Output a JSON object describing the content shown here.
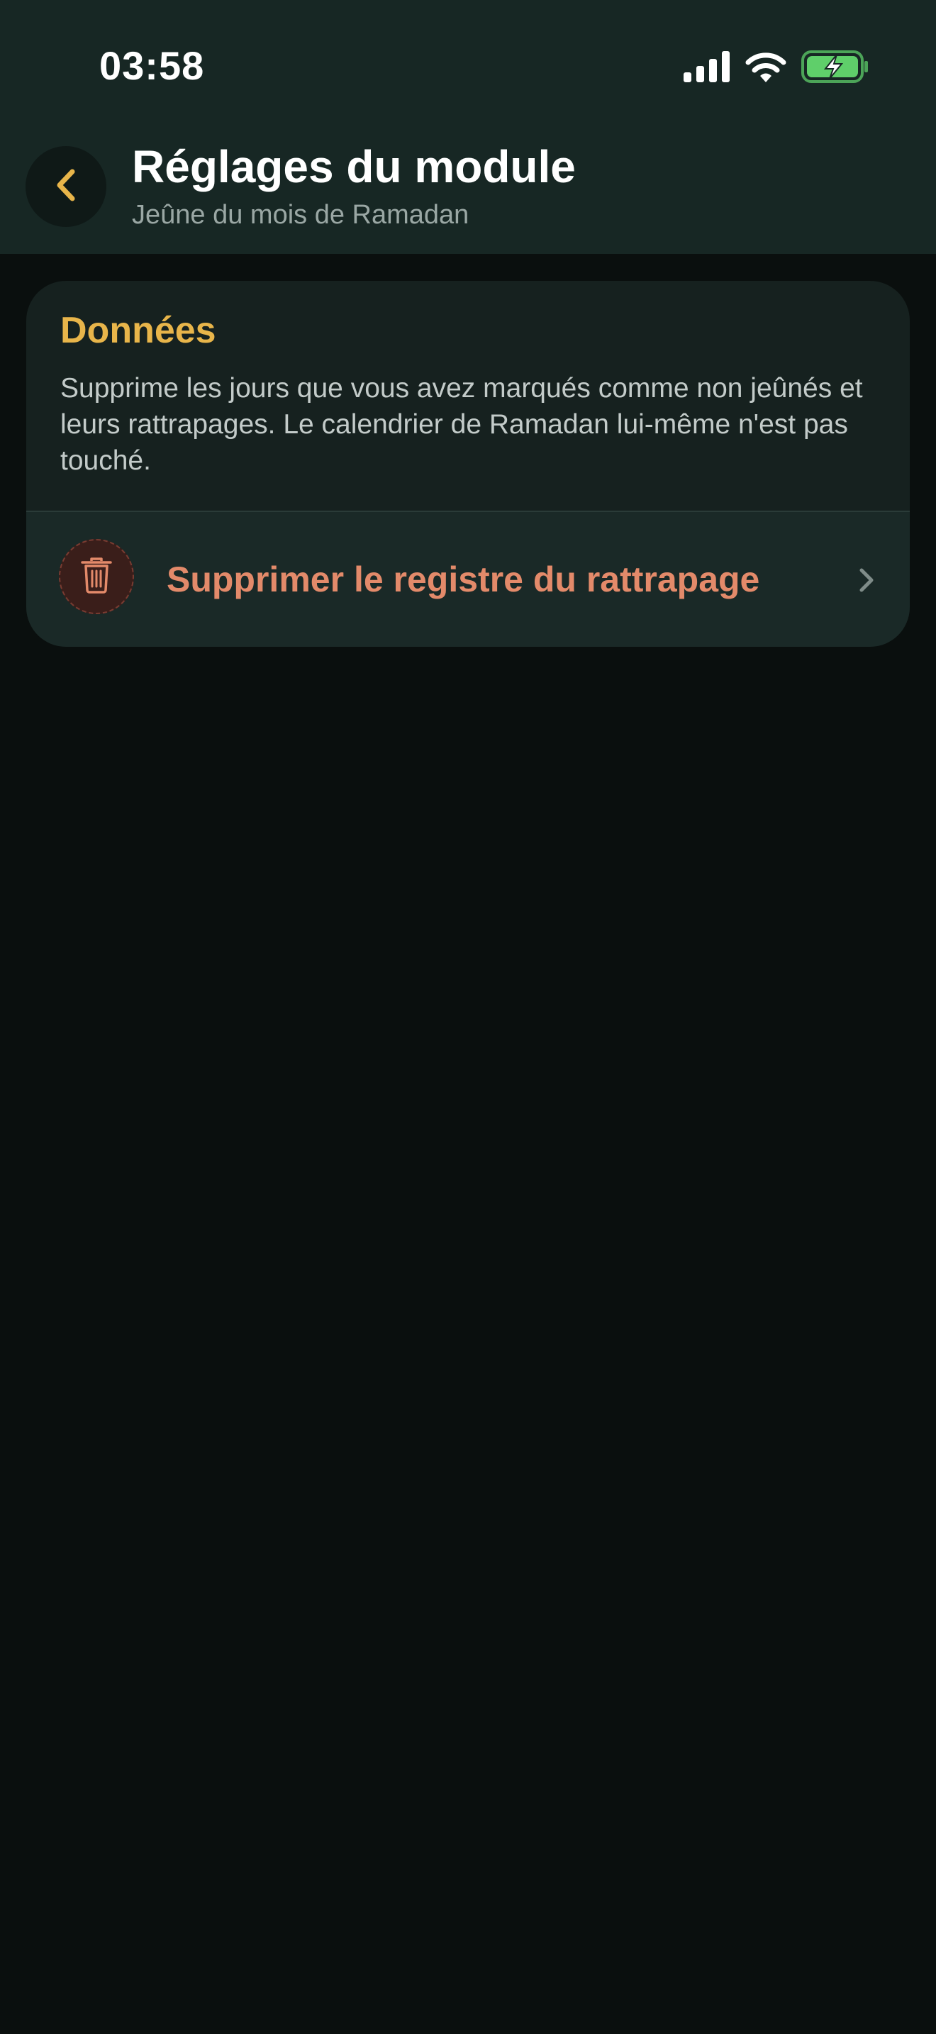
{
  "status_bar": {
    "time": "03:58",
    "icons": [
      "signal-icon",
      "wifi-icon",
      "battery-charging-icon"
    ]
  },
  "header": {
    "back_icon": "chevron-left-icon",
    "title": "Réglages du module",
    "subtitle": "Jeûne du mois de Ramadan"
  },
  "data_section": {
    "title": "Données",
    "description": "Supprime les jours que vous avez marqués comme non jeûnés et leurs rattrapages. Le calendrier de Ramadan lui-même n'est pas touché.",
    "action": {
      "icon": "trash-icon",
      "label": "Supprimer le registre du rattrapage",
      "trailing_icon": "chevron-right-icon"
    }
  },
  "colors": {
    "header_bg": "#172724",
    "page_bg": "#0a0f0e",
    "accent": "#e8b54a",
    "destructive": "#e38a6a",
    "battery": "#5fcf6a"
  }
}
